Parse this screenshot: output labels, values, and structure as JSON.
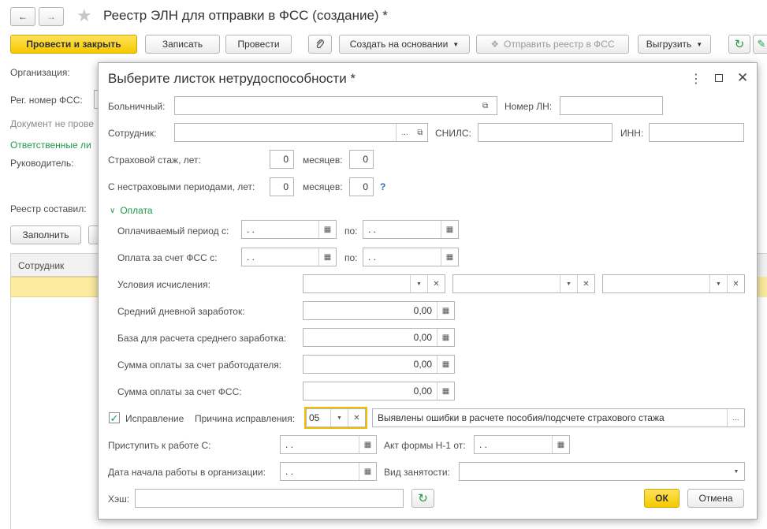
{
  "window": {
    "title": "Реестр ЭЛН для отправки в ФСС (создание) *"
  },
  "toolbar": {
    "post_close": "Провести и закрыть",
    "save": "Записать",
    "post": "Провести",
    "create_based": "Создать на основании",
    "send_registry": "Отправить реестр в ФСС",
    "export": "Выгрузить"
  },
  "background_form": {
    "organization_label": "Организация:",
    "reg_number_label": "Рег. номер ФСС:",
    "not_posted_text": "Документ не прове",
    "responsible_text": "Ответственные ли",
    "head_label": "Руководитель:",
    "compiled_label": "Реестр составил:",
    "fill_button": "Заполнить",
    "table_header_employee": "Сотрудник"
  },
  "dialog": {
    "title": "Выберите листок нетрудоспособности *",
    "sick_leave_label": "Больничный:",
    "sick_leave_value": "",
    "ln_number_label": "Номер ЛН:",
    "ln_number_value": "",
    "employee_label": "Сотрудник:",
    "employee_value": "",
    "snils_label": "СНИЛС:",
    "snils_value": "",
    "inn_label": "ИНН:",
    "inn_value": "",
    "insurance_years_label": "Страховой стаж, лет:",
    "insurance_years_value": "0",
    "months_label": "месяцев:",
    "insurance_months_value": "0",
    "noninsurance_years_label": "С нестраховыми периодами, лет:",
    "noninsurance_years_value": "0",
    "noninsurance_months_value": "0",
    "help_mark": "?",
    "payment_group": "Оплата",
    "paid_period_label": "Оплачиваемый период с:",
    "date_empty": " .  .",
    "to_label": "по:",
    "fss_payment_label": "Оплата за счет ФСС с:",
    "calc_conditions_label": "Условия исчисления:",
    "avg_daily_label": "Средний дневной заработок:",
    "avg_daily_value": "0,00",
    "avg_base_label": "База для расчета среднего заработка:",
    "avg_base_value": "0,00",
    "employer_sum_label": "Сумма оплаты за счет работодателя:",
    "employer_sum_value": "0,00",
    "fss_sum_label": "Сумма оплаты за счет ФСС:",
    "fss_sum_value": "0,00",
    "correction_label": "Исправление",
    "correction_checked": true,
    "correction_reason_label": "Причина исправления:",
    "correction_reason_code": "05",
    "correction_reason_text": "Выявлены ошибки в расчете пособия/подсчете страхового стажа",
    "start_work_label": "Приступить к работе С:",
    "act_n1_label": "Акт формы Н-1 от:",
    "start_org_label": "Дата начала работы в организации:",
    "employment_type_label": "Вид занятости:",
    "employment_type_value": "",
    "hash_label": "Хэш:",
    "hash_value": "",
    "ok_button": "ОК",
    "cancel_button": "Отмена"
  },
  "colors": {
    "accent_yellow": "#f5c800",
    "green": "#1f9a46",
    "help_blue": "#2a6ebb"
  }
}
